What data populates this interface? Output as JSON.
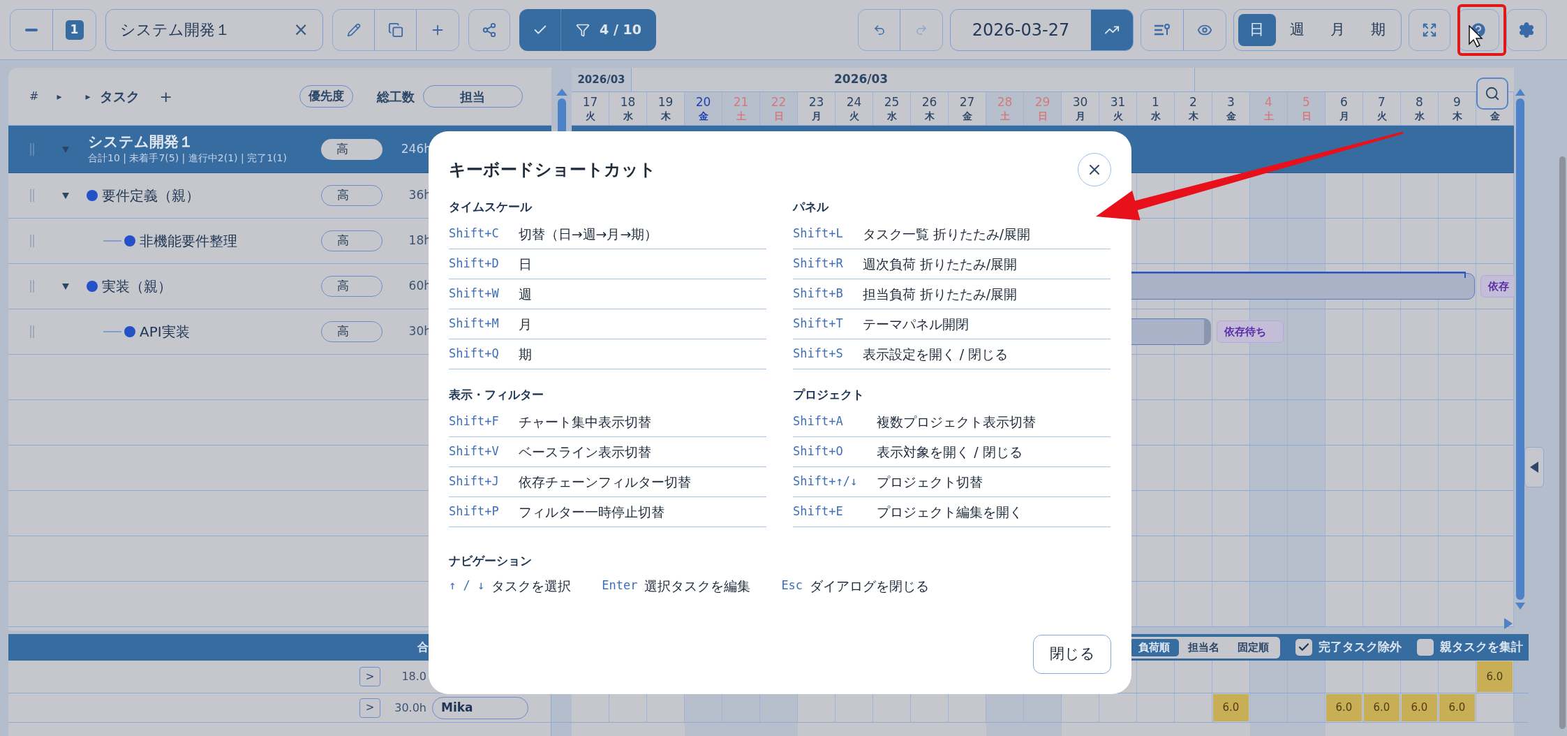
{
  "toolbar": {
    "zoom_level": "1",
    "project": "システム開発１",
    "clear": "×",
    "filter_on": true,
    "filter_count": "4 / 10",
    "date": "2026-03-27",
    "scales": [
      {
        "label": "日",
        "selected": true
      },
      {
        "label": "週",
        "selected": false
      },
      {
        "label": "月",
        "selected": false
      },
      {
        "label": "期",
        "selected": false
      }
    ]
  },
  "task_list": {
    "columns": {
      "number": "#",
      "expand_all": "▸",
      "collapse_all": "▸",
      "task": "タスク",
      "add": "+",
      "priority": "優先度",
      "effort": "総工数",
      "assignee": "担当"
    },
    "project": {
      "name": "システム開発１",
      "summary": "合計10 | 未着手7(5) | 進行中2(1) | 完了1(1)",
      "priority": "高",
      "effort": "246h",
      "selected": true,
      "expanded": true
    },
    "tasks": [
      {
        "name": "要件定義（親）",
        "priority": "高",
        "effort": "36h",
        "color": "#2450c8",
        "expanded": true,
        "children": [
          {
            "name": "非機能要件整理",
            "priority": "高",
            "effort": "18h",
            "color": "#2450c8"
          }
        ]
      },
      {
        "name": "実装（親）",
        "priority": "高",
        "effort": "60h",
        "color": "#2450c8",
        "expanded": true,
        "bar_badge": "依存",
        "children": [
          {
            "name": "API実装",
            "priority": "高",
            "effort": "30h",
            "color": "#2450c8",
            "bar_badge": "依存待ち"
          }
        ]
      }
    ]
  },
  "timeline": {
    "month_tab": "2026/03",
    "month_label": "2026/03",
    "days": [
      {
        "day": "17",
        "weekday": "火",
        "kind": "weekday"
      },
      {
        "day": "18",
        "weekday": "水",
        "kind": "weekday"
      },
      {
        "day": "19",
        "weekday": "木",
        "kind": "weekday"
      },
      {
        "day": "20",
        "weekday": "金",
        "kind": "holiday"
      },
      {
        "day": "21",
        "weekday": "土",
        "kind": "weekend"
      },
      {
        "day": "22",
        "weekday": "日",
        "kind": "weekend"
      },
      {
        "day": "23",
        "weekday": "月",
        "kind": "weekday"
      },
      {
        "day": "24",
        "weekday": "火",
        "kind": "weekday"
      },
      {
        "day": "25",
        "weekday": "水",
        "kind": "weekday"
      },
      {
        "day": "26",
        "weekday": "木",
        "kind": "weekday"
      },
      {
        "day": "27",
        "weekday": "金",
        "kind": "weekday"
      },
      {
        "day": "28",
        "weekday": "土",
        "kind": "weekend"
      },
      {
        "day": "29",
        "weekday": "日",
        "kind": "weekend"
      },
      {
        "day": "30",
        "weekday": "月",
        "kind": "weekday"
      },
      {
        "day": "31",
        "weekday": "火",
        "kind": "weekday"
      },
      {
        "day": "1",
        "weekday": "水",
        "kind": "weekday"
      },
      {
        "day": "2",
        "weekday": "木",
        "kind": "weekday"
      },
      {
        "day": "3",
        "weekday": "金",
        "kind": "weekday"
      },
      {
        "day": "4",
        "weekday": "土",
        "kind": "weekend"
      },
      {
        "day": "5",
        "weekday": "日",
        "kind": "weekend"
      },
      {
        "day": "6",
        "weekday": "月",
        "kind": "weekday"
      },
      {
        "day": "7",
        "weekday": "火",
        "kind": "weekday"
      },
      {
        "day": "8",
        "weekday": "水",
        "kind": "weekday"
      },
      {
        "day": "9",
        "weekday": "木",
        "kind": "weekday"
      },
      {
        "weekday": "金",
        "kind": "weekday"
      }
    ]
  },
  "load_panel": {
    "total": "合",
    "sort": [
      {
        "label": "負荷順",
        "selected": true
      },
      {
        "label": "担当名",
        "selected": false
      },
      {
        "label": "固定順",
        "selected": false
      }
    ],
    "options": [
      {
        "label": "完了タスク除外",
        "checked": true
      },
      {
        "label": "親タスクを集計",
        "checked": false
      }
    ],
    "rows": [
      {
        "expand": ">",
        "hours": "18.0",
        "cells": [
          {
            "kind": "empty"
          },
          {
            "kind": "empty"
          },
          {
            "kind": "empty"
          },
          {
            "kind": "empty"
          },
          {
            "kind": "empty"
          },
          {
            "kind": "empty"
          },
          {
            "kind": "empty"
          },
          {
            "kind": "empty"
          },
          {
            "kind": "empty"
          },
          {
            "kind": "empty"
          },
          {
            "kind": "empty"
          },
          {
            "kind": "empty"
          },
          {
            "kind": "empty"
          },
          {
            "kind": "empty"
          },
          {
            "kind": "empty"
          },
          {
            "kind": "empty"
          },
          {
            "kind": "empty"
          },
          {
            "kind": "empty"
          },
          {
            "kind": "empty"
          },
          {
            "kind": "empty"
          },
          {
            "kind": "empty"
          },
          {
            "kind": "empty"
          },
          {
            "kind": "empty"
          },
          {
            "kind": "empty"
          },
          {
            "kind": "load",
            "value": "6.0"
          }
        ]
      },
      {
        "expand": ">",
        "hours": "30.0h",
        "assignee": "Mika",
        "cells": [
          {
            "kind": "empty"
          },
          {
            "kind": "empty"
          },
          {
            "kind": "empty"
          },
          {
            "kind": "empty"
          },
          {
            "kind": "empty"
          },
          {
            "kind": "empty"
          },
          {
            "kind": "empty"
          },
          {
            "kind": "empty"
          },
          {
            "kind": "empty"
          },
          {
            "kind": "empty"
          },
          {
            "kind": "empty"
          },
          {
            "kind": "empty"
          },
          {
            "kind": "empty"
          },
          {
            "kind": "empty"
          },
          {
            "kind": "empty"
          },
          {
            "kind": "empty"
          },
          {
            "kind": "empty"
          },
          {
            "kind": "load",
            "value": "6.0"
          },
          {
            "kind": "empty"
          },
          {
            "kind": "empty"
          },
          {
            "kind": "load",
            "value": "6.0"
          },
          {
            "kind": "load",
            "value": "6.0"
          },
          {
            "kind": "load",
            "value": "6.0"
          },
          {
            "kind": "load",
            "value": "6.0"
          },
          {
            "kind": "empty"
          }
        ]
      }
    ]
  },
  "dialog": {
    "title": "キーボードショートカット",
    "columns": [
      [
        {
          "title": "タイムスケール",
          "items": [
            {
              "keys": "Shift+C",
              "label": "切替（日→週→月→期）"
            },
            {
              "keys": "Shift+D",
              "label": "日"
            },
            {
              "keys": "Shift+W",
              "label": "週"
            },
            {
              "keys": "Shift+M",
              "label": "月"
            },
            {
              "keys": "Shift+Q",
              "label": "期"
            }
          ]
        },
        {
          "title": "表示・フィルター",
          "items": [
            {
              "keys": "Shift+F",
              "label": "チャート集中表示切替"
            },
            {
              "keys": "Shift+V",
              "label": "ベースライン表示切替"
            },
            {
              "keys": "Shift+J",
              "label": "依存チェーンフィルター切替"
            },
            {
              "keys": "Shift+P",
              "label": "フィルター一時停止切替"
            }
          ]
        }
      ],
      [
        {
          "title": "パネル",
          "items": [
            {
              "keys": "Shift+L",
              "label": "タスク一覧 折りたたみ/展開"
            },
            {
              "keys": "Shift+R",
              "label": "週次負荷 折りたたみ/展開"
            },
            {
              "keys": "Shift+B",
              "label": "担当負荷 折りたたみ/展開"
            },
            {
              "keys": "Shift+T",
              "label": "テーマパネル開閉"
            },
            {
              "keys": "Shift+S",
              "label": "表示設定を開く / 閉じる"
            }
          ]
        },
        {
          "title": "プロジェクト",
          "items": [
            {
              "keys": "Shift+A",
              "label": "複数プロジェクト表示切替"
            },
            {
              "keys": "Shift+O",
              "label": "表示対象を開く / 閉じる"
            },
            {
              "keys": "Shift+↑/↓",
              "label": "プロジェクト切替"
            },
            {
              "keys": "Shift+E",
              "label": "プロジェクト編集を開く"
            }
          ]
        }
      ]
    ],
    "navigation": {
      "title": "ナビゲーション",
      "items": [
        {
          "keys": "↑ / ↓",
          "label": "タスクを選択"
        },
        {
          "keys": "Enter",
          "label": "選択タスクを編集"
        },
        {
          "keys": "Esc",
          "label": "ダイアログを閉じる"
        }
      ]
    },
    "close_button": "閉じる"
  }
}
